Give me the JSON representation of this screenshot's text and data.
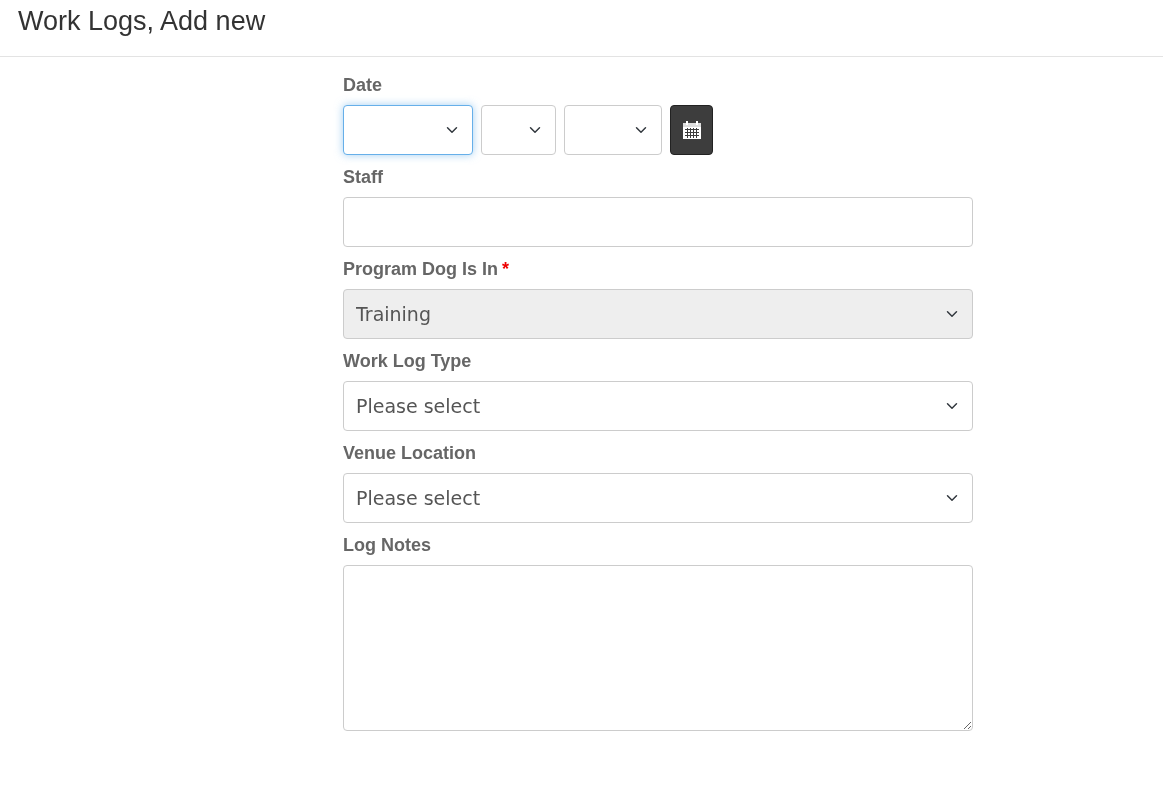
{
  "page_title": "Work Logs, Add new",
  "fields": [
    {
      "kind": "date",
      "label": "Date",
      "parts": [
        {
          "focused": true
        },
        {
          "focused": false
        },
        {
          "focused": false
        }
      ]
    },
    {
      "kind": "text",
      "label": "Staff"
    },
    {
      "kind": "select",
      "label": "Program Dog Is In",
      "required_mark": "*",
      "value": "Training",
      "disabled": true
    },
    {
      "kind": "select",
      "label": "Work Log Type",
      "value": "Please select",
      "disabled": false
    },
    {
      "kind": "select",
      "label": "Venue Location",
      "value": "Please select",
      "disabled": false
    },
    {
      "kind": "textarea",
      "label": "Log Notes"
    }
  ]
}
